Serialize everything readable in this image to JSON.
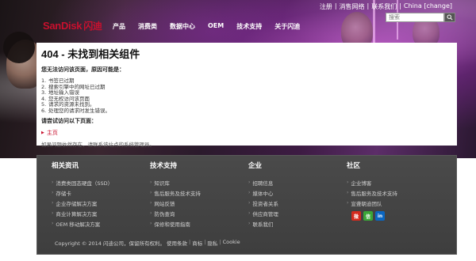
{
  "utility": {
    "links": [
      "注册",
      "消售网络",
      "联系我们",
      "China [change]"
    ],
    "separator": "|"
  },
  "search": {
    "placeholder": "搜索",
    "button_icon": "search-icon"
  },
  "logo": {
    "brand": "SanDisk",
    "cn": "闪迪"
  },
  "nav": {
    "items": [
      "产品",
      "消费类",
      "数据中心",
      "OEM",
      "技术支持",
      "关于闪迪"
    ]
  },
  "content": {
    "title": "404 - 未找到相关组件",
    "subhead": "您无法访问该页面，原因可能是：",
    "reasons": [
      {
        "num": "1.",
        "text": "书签已过期"
      },
      {
        "num": "2.",
        "text": "搜索引擎中的网址已过期"
      },
      {
        "num": "3.",
        "text": "地址输入错误"
      },
      {
        "num": "4.",
        "text": "您无权访问该页面"
      },
      {
        "num": "5.",
        "text": "请求的资源未找到。"
      },
      {
        "num": "6.",
        "text": "处理您的请求时发生错误。"
      }
    ],
    "try_head": "请尝试访问以下页面：",
    "home_link": "主页",
    "note": "如果问题依然存在，请联系该站点的系统管理员。"
  },
  "footer": {
    "columns": [
      {
        "head": "相关资讯",
        "items": [
          "消费类固态硬盘（SSD）",
          "存储卡",
          "企业存储解决方案",
          "商业计算解决方案",
          "OEM 移动解决方案"
        ]
      },
      {
        "head": "技术支持",
        "items": [
          "知识库",
          "售后服务及技术支持",
          "网站反馈",
          "防伪查询",
          "保修和使用指南"
        ]
      },
      {
        "head": "企业",
        "items": [
          "招聘信息",
          "媒体中心",
          "投资者关系",
          "供应商管理",
          "联系我们"
        ]
      },
      {
        "head": "社区",
        "items": [
          "企业博客",
          "售后服务及技术支持",
          "宣聋朝迪团队"
        ]
      }
    ],
    "social": [
      {
        "name": "weibo-icon",
        "label": "微",
        "color": "#d52b1e"
      },
      {
        "name": "wechat-icon",
        "label": "信",
        "color": "#3aa637"
      },
      {
        "name": "linkedin-icon",
        "label": "in",
        "color": "#0a66c2"
      }
    ],
    "copyright": [
      "Copyright © 2014 闪迪公司，保留所有权利。",
      "使用条款",
      "商标",
      "隐私",
      "Cookie"
    ]
  },
  "colors": {
    "brand_red": "#c8102e",
    "footer_bg": "#454545"
  }
}
